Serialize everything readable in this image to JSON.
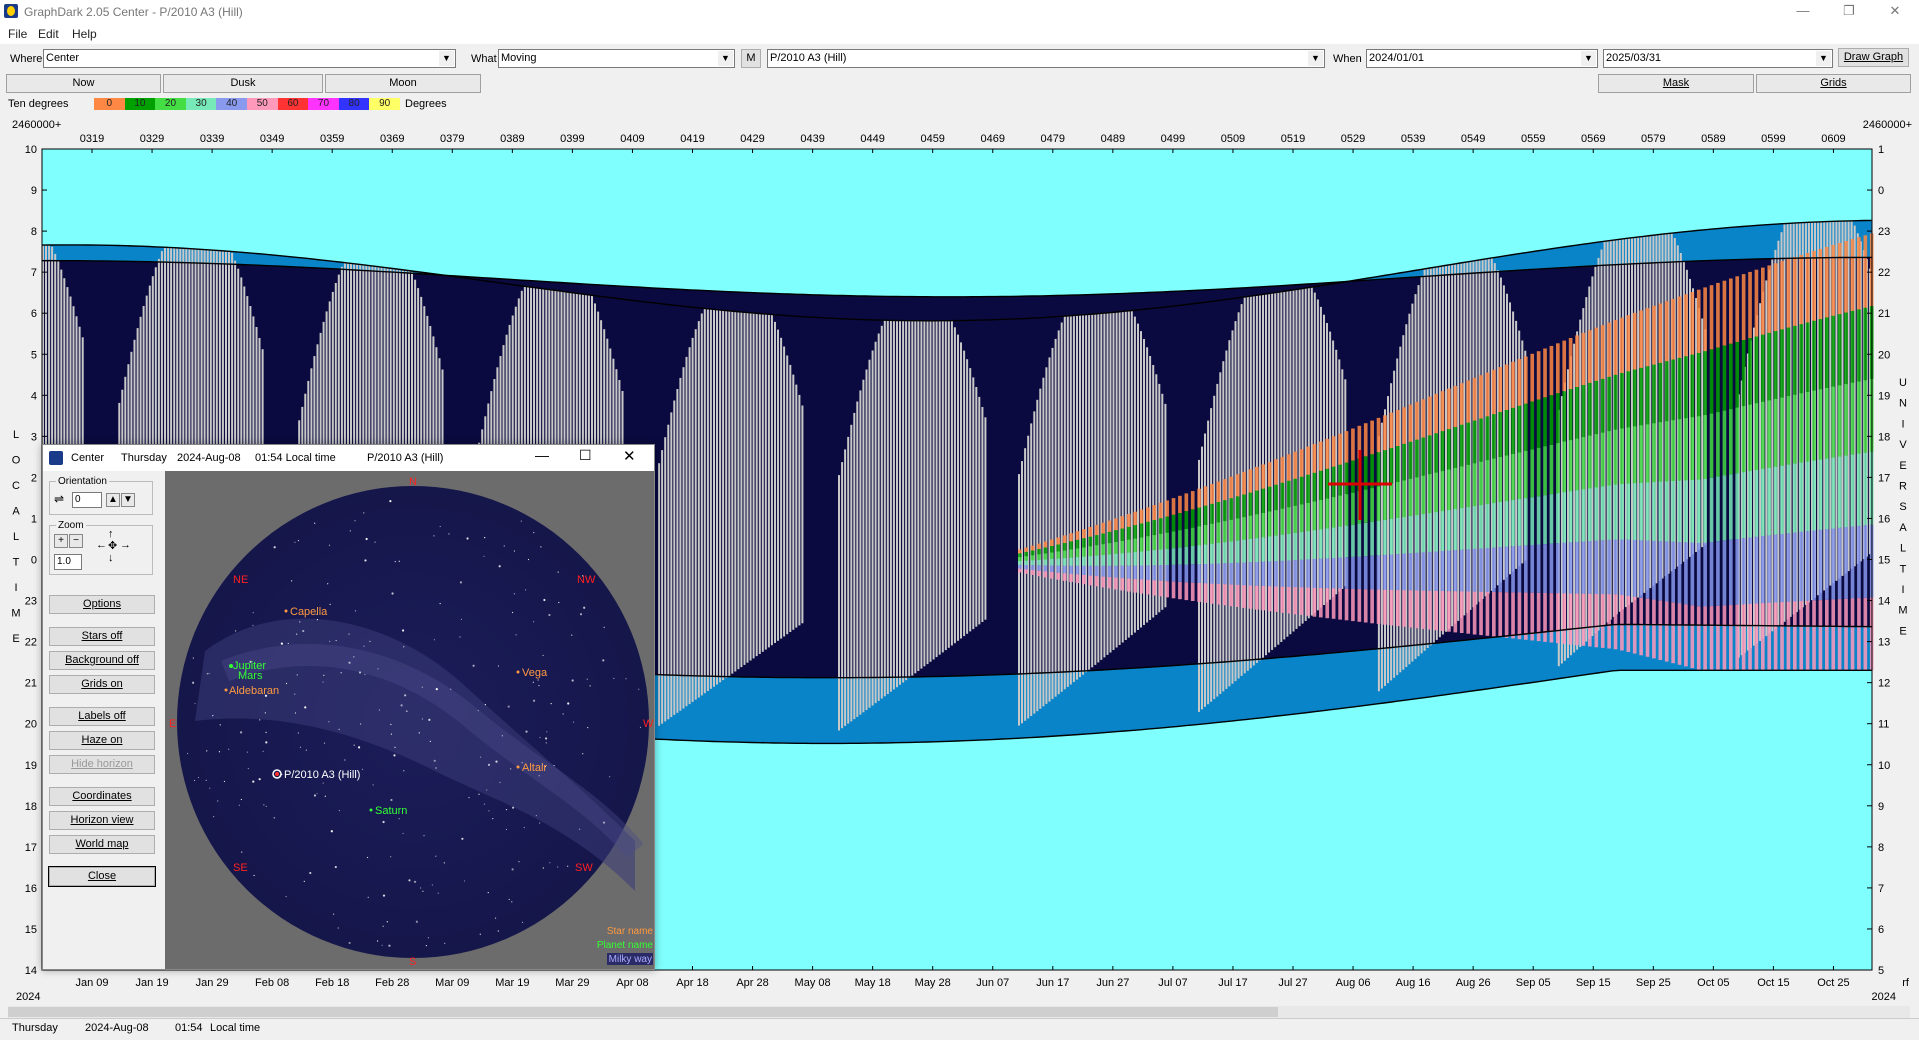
{
  "window": {
    "title": "GraphDark 2.05  Center  -  P/2010 A3 (Hill)",
    "minimize": "—",
    "maximize": "❐",
    "close": "✕"
  },
  "menu": [
    "File",
    "Edit",
    "Help"
  ],
  "toolbar": {
    "where_label": "Where",
    "where_value": "Center",
    "what_label": "What",
    "what_value": "Moving",
    "m_button": "M",
    "object_value": "P/2010 A3 (Hill)",
    "when_label": "When",
    "when_start": "2024/01/01",
    "when_end": "2025/03/31",
    "draw_graph": "Draw Graph"
  },
  "quick_buttons": [
    "Now",
    "Dusk",
    "Moon"
  ],
  "right_buttons": [
    "Mask",
    "Grids"
  ],
  "legend": {
    "label_left": "Ten degrees",
    "label_right": "Degrees",
    "swatches": [
      {
        "label": "0",
        "color": "#ff8844"
      },
      {
        "label": "10",
        "color": "#00a000"
      },
      {
        "label": "20",
        "color": "#44dd44"
      },
      {
        "label": "30",
        "color": "#77e8b8"
      },
      {
        "label": "40",
        "color": "#8899ee"
      },
      {
        "label": "50",
        "color": "#ff99bb"
      },
      {
        "label": "60",
        "color": "#ff3333"
      },
      {
        "label": "70",
        "color": "#ff33ff"
      },
      {
        "label": "80",
        "color": "#3333ff"
      },
      {
        "label": "90",
        "color": "#ffff66"
      }
    ]
  },
  "chart_data": {
    "type": "heatmap",
    "top_left_label": "2460000+",
    "top_right_label": "2460000+",
    "jd_ticks": [
      "0319",
      "0329",
      "0339",
      "0349",
      "0359",
      "0369",
      "0379",
      "0389",
      "0399",
      "0409",
      "0419",
      "0429",
      "0439",
      "0449",
      "0459",
      "0469",
      "0479",
      "0489",
      "0499",
      "0509",
      "0519",
      "0529",
      "0539",
      "0549",
      "0559",
      "0569",
      "0579",
      "0589",
      "0599",
      "0609"
    ],
    "date_ticks": [
      "Jan 09",
      "Jan 19",
      "Jan 29",
      "Feb 08",
      "Feb 18",
      "Feb 28",
      "Mar 09",
      "Mar 19",
      "Mar 29",
      "Apr 08",
      "Apr 18",
      "Apr 28",
      "May 08",
      "May 18",
      "May 28",
      "Jun 07",
      "Jun 17",
      "Jun 27",
      "Jul 07",
      "Jul 17",
      "Jul 27",
      "Aug 06",
      "Aug 16",
      "Aug 26",
      "Sep 05",
      "Sep 15",
      "Sep 25",
      "Oct 05",
      "Oct 15",
      "Oct 25"
    ],
    "year_left": "2024",
    "year_right": "2024",
    "bottom_right_label": "rf",
    "left_axis_ticks": [
      "10",
      "9",
      "8",
      "7",
      "6",
      "5",
      "4",
      "3",
      "2",
      "1",
      "0",
      "23",
      "22",
      "21",
      "20",
      "19",
      "18",
      "17",
      "16",
      "15",
      "14"
    ],
    "right_axis_ticks": [
      "1",
      "0",
      "23",
      "22",
      "21",
      "20",
      "19",
      "18",
      "17",
      "16",
      "15",
      "14",
      "13",
      "12",
      "11",
      "10",
      "9",
      "8",
      "7",
      "6",
      "5"
    ],
    "left_axis_title": "LOCAL TIME",
    "right_axis_title": "UNIVERSAL TIME",
    "colors": {
      "day": "#80ffff",
      "night": "#0a0a40",
      "twilight": "#0a84c8",
      "moon": "#c8c8c8"
    }
  },
  "status": {
    "day": "Thursday",
    "date": "2024-Aug-08",
    "time": "01:54",
    "time_label": "Local time"
  },
  "dialog": {
    "title_location": "Center",
    "title_day": "Thursday",
    "title_date": "2024-Aug-08",
    "title_time": "01:54 Local time",
    "title_object": "P/2010 A3 (Hill)",
    "orientation_label": "Orientation",
    "orientation_value": "0",
    "zoom_label": "Zoom",
    "zoom_value": "1.0",
    "buttons": [
      "Options",
      "Stars off",
      "Background off",
      "Grids on",
      "Labels off",
      "Haze on",
      "Hide horizon",
      "Coordinates",
      "Horizon view",
      "World map",
      "Close"
    ],
    "compass": [
      "N",
      "NE",
      "NW",
      "E",
      "W",
      "SE",
      "SW",
      "S"
    ],
    "objects": [
      {
        "name": "Capella",
        "color": "#ff9a40"
      },
      {
        "name": "Jupiter",
        "color": "#33ff33"
      },
      {
        "name": "Mars",
        "color": "#33ff33"
      },
      {
        "name": "Aldebaran",
        "color": "#ff9a40"
      },
      {
        "name": "Vega",
        "color": "#ff9a40"
      },
      {
        "name": "P/2010 A3 (Hill)",
        "color": "#ffffff"
      },
      {
        "name": "Altair",
        "color": "#ff9a40"
      },
      {
        "name": "Saturn",
        "color": "#33ff33"
      }
    ],
    "legend_star": "Star name",
    "legend_planet": "Planet name",
    "legend_milky": "Milky way"
  }
}
